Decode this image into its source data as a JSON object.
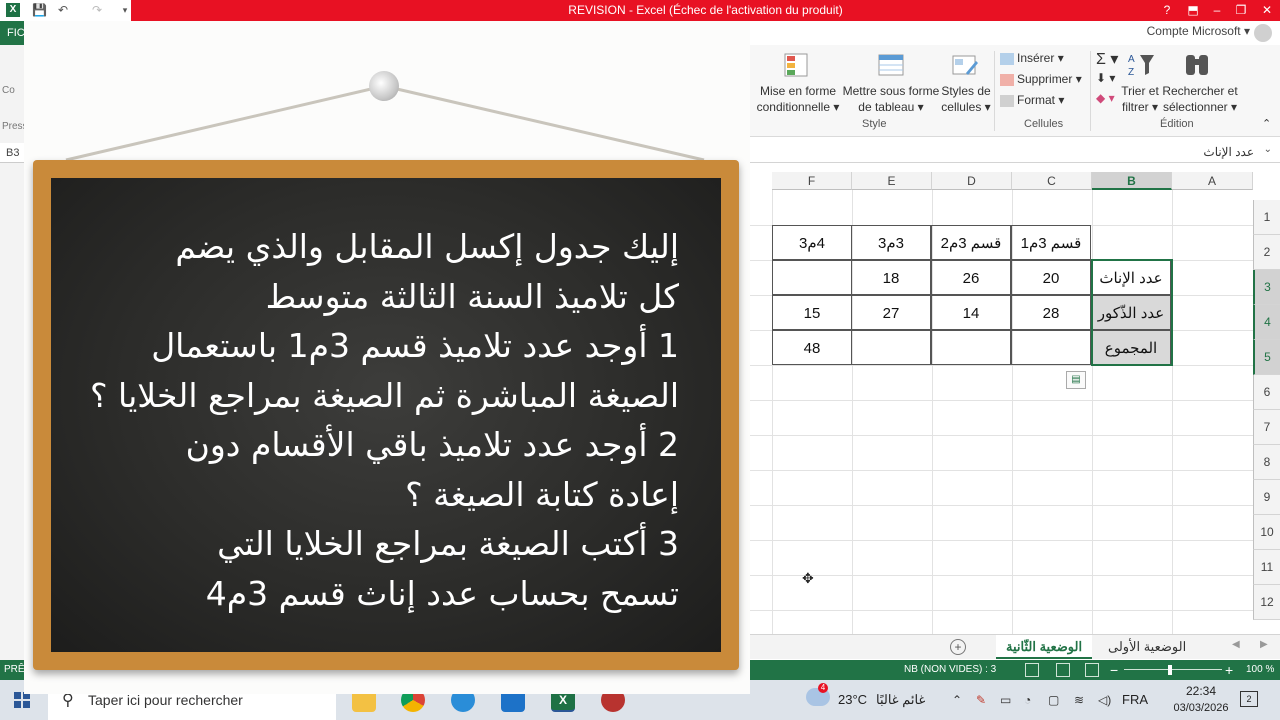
{
  "window": {
    "title": "REVISION  -  Excel (Échec de l'activation du produit)",
    "help": "?",
    "minimize": "–",
    "restore": "❐",
    "close": "✕"
  },
  "ribbon": {
    "tab_file": "FICHIER",
    "account": "Compte Microsoft",
    "mise_en_forme": [
      "Mise en forme",
      "conditionnelle"
    ],
    "mettre_sous_forme": [
      "Mettre sous forme",
      "de tableau"
    ],
    "styles_cellules": [
      "Styles de",
      "cellules"
    ],
    "group_style": "Style",
    "inserer": "Insérer",
    "supprimer": "Supprimer",
    "format": "Format",
    "group_cellules": "Cellules",
    "trier": [
      "Trier et",
      "filtrer"
    ],
    "rechercher": [
      "Rechercher et",
      "sélectionner"
    ],
    "group_edition": "Édition",
    "left_labels": [
      "Co",
      "Press"
    ]
  },
  "formula_bar": {
    "name_box": "B3",
    "value": "عدد الإناث"
  },
  "grid": {
    "columns": [
      "F",
      "E",
      "D",
      "C",
      "B",
      "A"
    ],
    "rows": [
      "1",
      "2",
      "3",
      "4",
      "5",
      "6",
      "7",
      "8",
      "9",
      "10",
      "11",
      "12"
    ],
    "cells": {
      "F2": "4م3",
      "E2": "3م3",
      "D2": "قسم 3م2",
      "C2": "قسم 3م1",
      "E3": "18",
      "D3": "26",
      "C3": "20",
      "B3": "عدد الإناث",
      "F4": "15",
      "E4": "27",
      "D4": "14",
      "C4": "28",
      "B4": "عدد الذّكور",
      "F5": "48",
      "B5": "المجموع"
    }
  },
  "sheets": {
    "tabs": [
      "الوضعية الثّانية",
      "الوضعية الأولى"
    ],
    "active": "الوضعية الثّانية",
    "add": "+"
  },
  "status": {
    "left": "PRÊT",
    "count": "NB (NON VIDES) : 3",
    "zoom": "100 %"
  },
  "taskbar": {
    "search_placeholder": "Taper ici pour rechercher",
    "weather_temp": "23°C",
    "weather_desc": "غائم غالبًا",
    "weather_badge": "4",
    "lang": "FRA",
    "time": "22:34",
    "date": "03/03/2026",
    "notifications": "2"
  },
  "board": {
    "lines": [
      "إليك جدول إكسل المقابل والذي يضم",
      "كل تلاميذ السنة الثالثة متوسط",
      "1 أوجد  عدد تلاميذ قسم 3م1 باستعمال",
      "الصيغة المباشرة ثم الصيغة بمراجع الخلايا ؟",
      "2 أوجد عدد تلاميذ باقي الأقسام دون",
      "إعادة كتابة الصيغة ؟",
      "3 أكتب الصيغة بمراجع الخلايا التي",
      "تسمح بحساب عدد إناث قسم 3م4"
    ]
  },
  "colors": {
    "excel_green": "#217346",
    "title_red": "#e81123",
    "board_frame": "#c98a3a",
    "chalkboard": "#2c2c2a"
  }
}
